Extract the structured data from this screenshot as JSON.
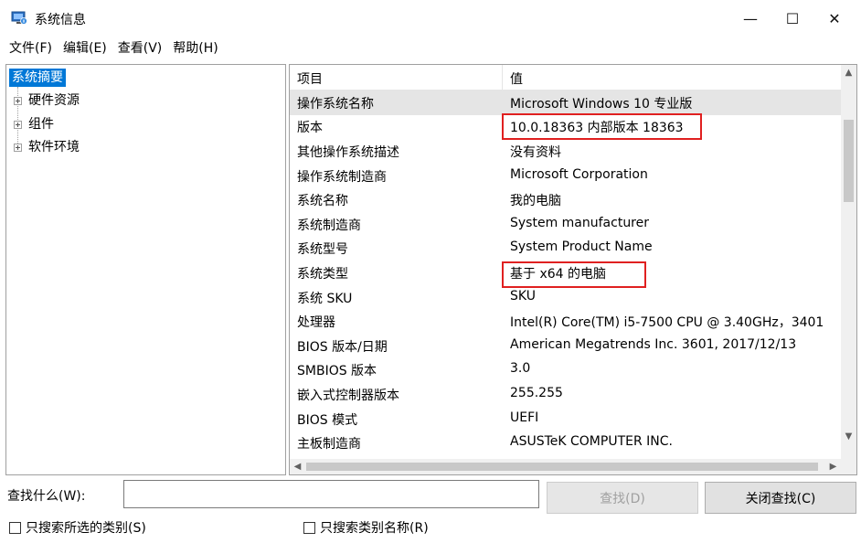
{
  "window": {
    "title": "系统信息",
    "minimize_glyph": "—",
    "maximize_glyph": "☐",
    "close_glyph": "✕"
  },
  "menu": [
    "文件(F)",
    "编辑(E)",
    "查看(V)",
    "帮助(H)"
  ],
  "tree": {
    "selected": "系统摘要",
    "children": [
      "硬件资源",
      "组件",
      "软件环境"
    ]
  },
  "list": {
    "headers": {
      "item": "项目",
      "value": "值"
    },
    "rows": [
      {
        "item": "操作系统名称",
        "value": "Microsoft Windows 10 专业版"
      },
      {
        "item": "版本",
        "value": "10.0.18363 内部版本 18363"
      },
      {
        "item": "其他操作系统描述",
        "value": "没有资料"
      },
      {
        "item": "操作系统制造商",
        "value": "Microsoft Corporation"
      },
      {
        "item": "系统名称",
        "value": "我的电脑"
      },
      {
        "item": "系统制造商",
        "value": "System manufacturer"
      },
      {
        "item": "系统型号",
        "value": "System Product Name"
      },
      {
        "item": "系统类型",
        "value": "基于 x64 的电脑"
      },
      {
        "item": "系统 SKU",
        "value": "SKU"
      },
      {
        "item": "处理器",
        "value": "Intel(R) Core(TM) i5-7500 CPU @ 3.40GHz，3401"
      },
      {
        "item": "BIOS 版本/日期",
        "value": "American Megatrends Inc. 3601, 2017/12/13"
      },
      {
        "item": "SMBIOS 版本",
        "value": "3.0"
      },
      {
        "item": "嵌入式控制器版本",
        "value": "255.255"
      },
      {
        "item": "BIOS 模式",
        "value": "UEFI"
      },
      {
        "item": "主板制造商",
        "value": "ASUSTeK COMPUTER INC."
      }
    ],
    "selected_row_index": 0,
    "highlighted_row_indices": [
      1,
      7
    ]
  },
  "find": {
    "label": "查找什么(W):",
    "input_value": "",
    "find_button": "查找(D)",
    "close_find_button": "关闭查找(C)",
    "check_selected_category": "只搜索所选的类别(S)",
    "check_category_names": "只搜索类别名称(R)"
  },
  "colors": {
    "selection": "#0078d7",
    "highlight_box": "#e02020",
    "row_selected": "#e5e5e5"
  }
}
